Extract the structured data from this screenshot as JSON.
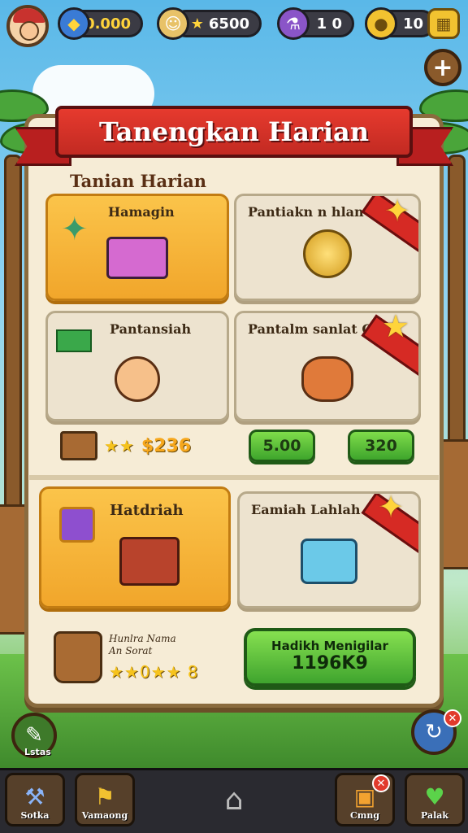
{
  "topbar": {
    "avatar_icon": "player-avatar",
    "resource1_value": "0.000",
    "resource1_icon": "gem-icon",
    "resource2_value": "6500",
    "resource2_icon": "star-icon",
    "resource3_value": "1 0",
    "resource3_icon": "potion-icon",
    "resource4_value": "10",
    "resource4_icon": "coin-stack-icon",
    "settings_icon": "grid-icon"
  },
  "panel": {
    "banner_title": "Tanengkan Harian",
    "subtitle": "Tanian Harian",
    "cards": [
      {
        "title": "Hamagin",
        "icon": "chest-icon",
        "highlight": true
      },
      {
        "title": "Pantiakn n hlan",
        "icon": "gold-coin-icon",
        "highlight": false
      },
      {
        "title": "Pantansiah",
        "icon": "character-icon",
        "highlight": false
      },
      {
        "title": "Pantalm sanlat Cem",
        "icon": "pet-icon",
        "highlight": false
      },
      {
        "title": "Hatdriah",
        "icon": "gift-box-icon",
        "highlight": true
      },
      {
        "title": "Eamiah Lahlah",
        "icon": "crystal-box-icon",
        "highlight": false
      }
    ],
    "row1_stars": "★★",
    "row1_value": "$236",
    "btn_left": "5.00",
    "btn_right": "320",
    "bottom_text_line1": "Hunlra Nama",
    "bottom_text_line2": "An Sorat",
    "bottom_stars": "★★0★★ 8",
    "big_button_line1": "Hadikh Menigilar",
    "big_button_line2": "1196K9"
  },
  "side": {
    "left_label": "Lstas",
    "right_icon": "refresh-icon"
  },
  "navbar": {
    "items": [
      {
        "label": "Sotka",
        "icon": "hammer-icon"
      },
      {
        "label": "Vamaong",
        "icon": "flag-icon"
      },
      {
        "label": "",
        "icon": "home-icon"
      },
      {
        "label": "Cmng",
        "icon": "chest-icon"
      },
      {
        "label": "Palak",
        "icon": "heart-icon"
      }
    ]
  }
}
